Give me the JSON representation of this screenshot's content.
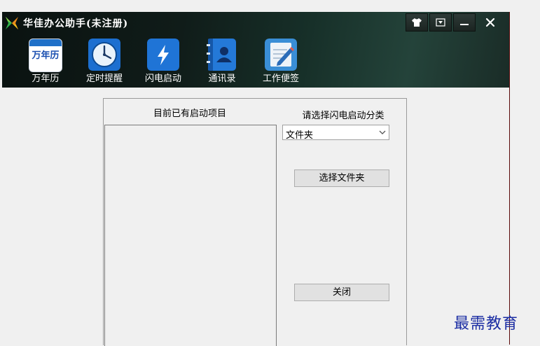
{
  "app": {
    "title": "华佳办公助手(未注册)",
    "accent_color": "#173029"
  },
  "window_controls": [
    {
      "icon": "shirt-icon"
    },
    {
      "icon": "dropdown-box-icon"
    },
    {
      "icon": "minimize-icon"
    },
    {
      "icon": "close-icon"
    }
  ],
  "toolbar": {
    "items": [
      {
        "label": "万年历",
        "icon": "calendar-icon",
        "icon_text": "万年历"
      },
      {
        "label": "定时提醒",
        "icon": "clock-icon"
      },
      {
        "label": "闪电启动",
        "icon": "lightning-icon"
      },
      {
        "label": "通讯录",
        "icon": "contacts-book-icon"
      },
      {
        "label": "工作便签",
        "icon": "notepad-pencil-icon"
      }
    ]
  },
  "panel": {
    "list_header": "目前已有启动项目",
    "category_label": "请选择闪电启动分类",
    "category_selected": "文件夹",
    "select_folder_button": "选择文件夹",
    "close_button": "关闭"
  },
  "watermark": "最需教育"
}
